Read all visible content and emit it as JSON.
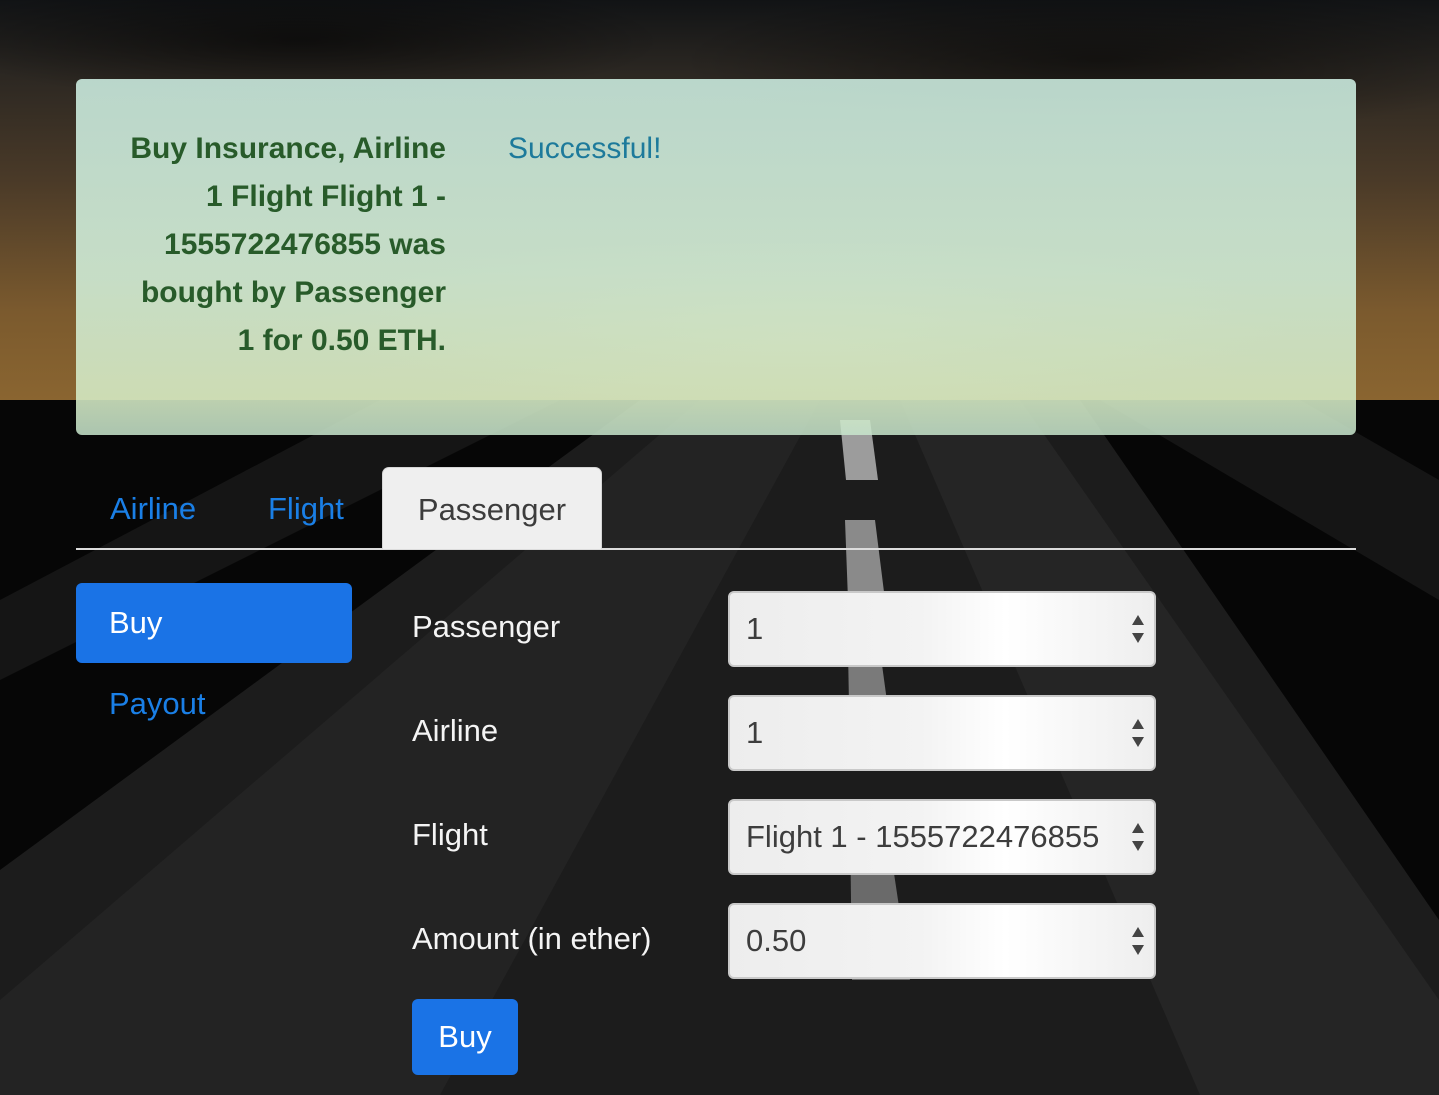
{
  "alert": {
    "label": "Buy Insurance, Airline 1 Flight Flight 1 - 1555722476855 was bought by Passenger 1 for 0.50 ETH.",
    "message": "Successful!"
  },
  "tabs": [
    {
      "label": "Airline",
      "active": false
    },
    {
      "label": "Flight",
      "active": false
    },
    {
      "label": "Passenger",
      "active": true
    }
  ],
  "side_nav": [
    {
      "label": "Buy",
      "active": true
    },
    {
      "label": "Payout",
      "active": false
    }
  ],
  "form": {
    "passenger": {
      "label": "Passenger",
      "value": "1"
    },
    "airline": {
      "label": "Airline",
      "value": "1"
    },
    "flight": {
      "label": "Flight",
      "value": "Flight 1 - 1555722476855"
    },
    "amount": {
      "label": "Amount (in ether)",
      "value": "0.50"
    },
    "submit_label": "Buy"
  },
  "colors": {
    "accent": "#1a73e6",
    "link": "#1a7fe6",
    "alert_text": "#285b2a",
    "alert_status": "#1d7a9b"
  }
}
